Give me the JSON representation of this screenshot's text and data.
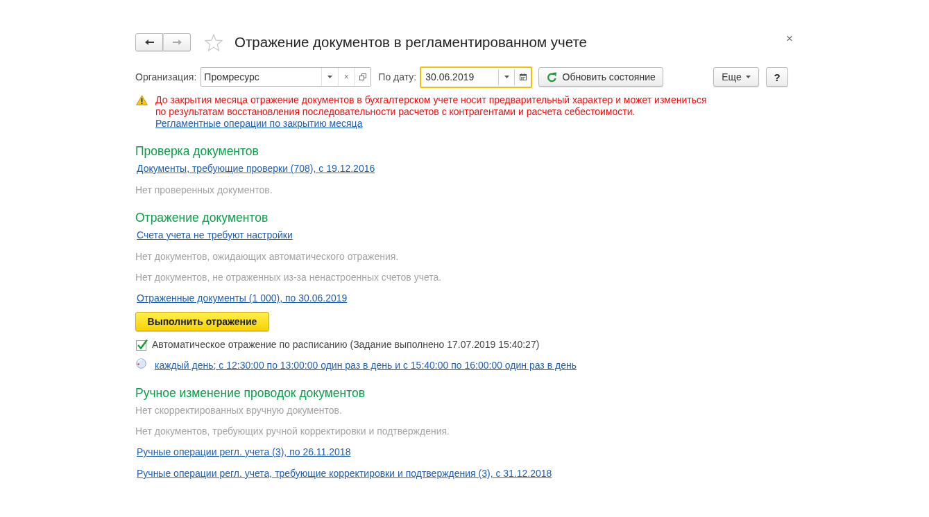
{
  "window": {
    "title": "Отражение документов в регламентированном учете",
    "close": "×"
  },
  "nav": [
    {
      "kind": "back",
      "disabled": false
    },
    {
      "kind": "forward",
      "disabled": true
    }
  ],
  "toolbar": {
    "organization": {
      "label": "Организация:",
      "value": "Промресурс",
      "clear": "×"
    },
    "date": {
      "label": "По дату:",
      "value": "30.06.2019",
      "focused": true
    },
    "refresh_button": "Обновить состояние",
    "more_button": "Еще",
    "help_button": "?"
  },
  "warning": {
    "text": "До закрытия месяца отражение документов в бухгалтерском учете носит предварительный характер и может измениться по результатам восстановления последовательности расчетов с контрагентами и расчета себестоимости.",
    "link": "Регламентные операции по закрытию месяца"
  },
  "sections": [
    {
      "title": "Проверка документов",
      "items": [
        {
          "kind": "link",
          "text": "Документы, требующие проверки (708), с 19.12.2016"
        },
        {
          "kind": "note",
          "text": "Нет проверенных документов."
        }
      ]
    },
    {
      "title": "Отражение документов",
      "items": [
        {
          "kind": "link",
          "text": "Счета учета не требуют настройки"
        },
        {
          "kind": "note",
          "text": "Нет документов, ожидающих автоматического отражения."
        },
        {
          "kind": "note",
          "text": "Нет документов, не отраженных из-за ненастроенных счетов учета."
        },
        {
          "kind": "link",
          "text": "Отраженные документы (1 000), по 30.06.2019"
        },
        {
          "kind": "button",
          "text": "Выполнить отражение"
        },
        {
          "kind": "checkbox",
          "text": "Автоматическое отражение по расписанию (Задание выполнено 17.07.2019 15:40:27)",
          "checked": true
        },
        {
          "kind": "schedule",
          "text": "каждый день; с 12:30:00 по 13:00:00 один раз в день и с 15:40:00 по 16:00:00 один раз в день"
        }
      ]
    },
    {
      "title": "Ручное изменение проводок документов",
      "items": [
        {
          "kind": "note",
          "text": "Нет скорректированных вручную документов."
        },
        {
          "kind": "note",
          "text": "Нет документов, требующих ручной корректировки и подтверждения."
        },
        {
          "kind": "link",
          "text": "Ручные операции регл. учета (3), по 26.11.2018"
        },
        {
          "kind": "link",
          "text": "Ручные операции регл. учета, требующие корректировки и подтверждения (3), с 31.12.2018"
        }
      ]
    }
  ]
}
